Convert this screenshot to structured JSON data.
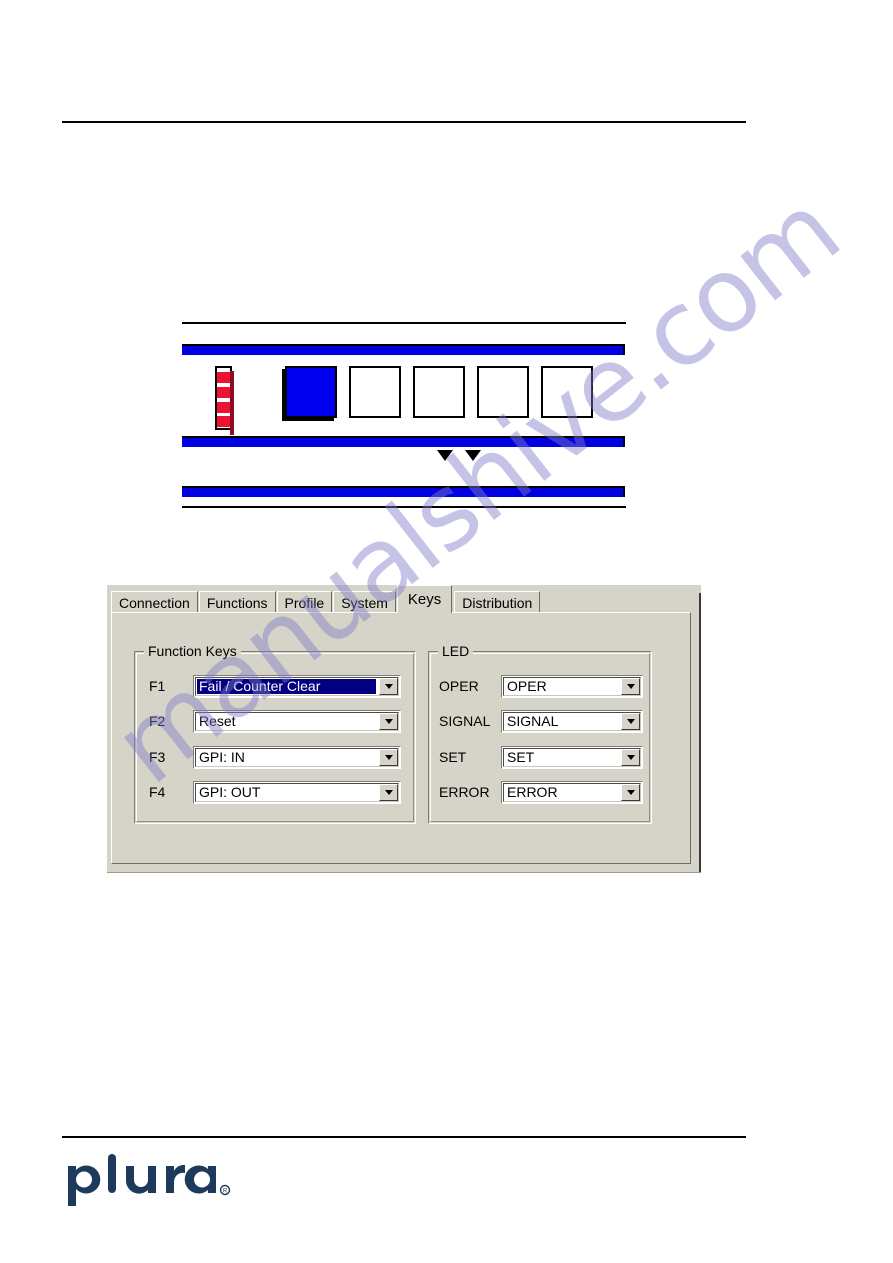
{
  "page": {
    "watermark_text": "manualshive.com",
    "brand": "plura",
    "brand_mark": "®"
  },
  "device_panel": {
    "name": "front-panel-illustration",
    "led_bar": {
      "name": "status-led-bar",
      "segment_count": 4,
      "color": "#ee1133"
    },
    "keys": [
      {
        "label": "",
        "state": "active",
        "color": "#0000ee"
      },
      {
        "label": "",
        "state": "inactive",
        "color": "#ffffff"
      },
      {
        "label": "",
        "state": "inactive",
        "color": "#ffffff"
      },
      {
        "label": "",
        "state": "inactive",
        "color": "#ffffff"
      },
      {
        "label": "",
        "state": "inactive",
        "color": "#ffffff"
      }
    ],
    "bars": [
      {
        "name": "display-bar-top",
        "color": "#0000e0"
      },
      {
        "name": "display-bar-middle",
        "color": "#0000e0"
      },
      {
        "name": "display-bar-bottom",
        "color": "#0000e0"
      }
    ],
    "markers": [
      {
        "name": "pointer-marker-left"
      },
      {
        "name": "pointer-marker-right"
      }
    ]
  },
  "dialog": {
    "tabs": [
      {
        "label": "Connection",
        "active": false
      },
      {
        "label": "Functions",
        "active": false
      },
      {
        "label": "Profile",
        "active": false
      },
      {
        "label": "System",
        "active": false
      },
      {
        "label": "Keys",
        "active": true
      },
      {
        "label": "Distribution",
        "active": false
      }
    ],
    "function_keys": {
      "title": "Function Keys",
      "rows": [
        {
          "label": "F1",
          "value": "Fail / Counter Clear",
          "selected": true
        },
        {
          "label": "F2",
          "value": "Reset",
          "selected": false
        },
        {
          "label": "F3",
          "value": "GPI: IN",
          "selected": false
        },
        {
          "label": "F4",
          "value": "GPI: OUT",
          "selected": false
        }
      ]
    },
    "led": {
      "title": "LED",
      "rows": [
        {
          "label": "OPER",
          "value": "OPER"
        },
        {
          "label": "SIGNAL",
          "value": "SIGNAL"
        },
        {
          "label": "SET",
          "value": "SET"
        },
        {
          "label": "ERROR",
          "value": "ERROR"
        }
      ]
    },
    "colors": {
      "dialog_background": "#d6d3c8",
      "selection": "#000080",
      "field_background": "#ffffff"
    }
  }
}
